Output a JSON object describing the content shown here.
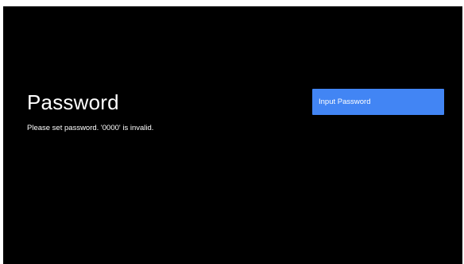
{
  "page": {
    "title": "Password",
    "message": "Please set password. '0000' is invalid."
  },
  "actions": {
    "input_password_label": "Input Password"
  },
  "colors": {
    "background": "#000000",
    "accent": "#4285f4",
    "text": "#ffffff"
  }
}
